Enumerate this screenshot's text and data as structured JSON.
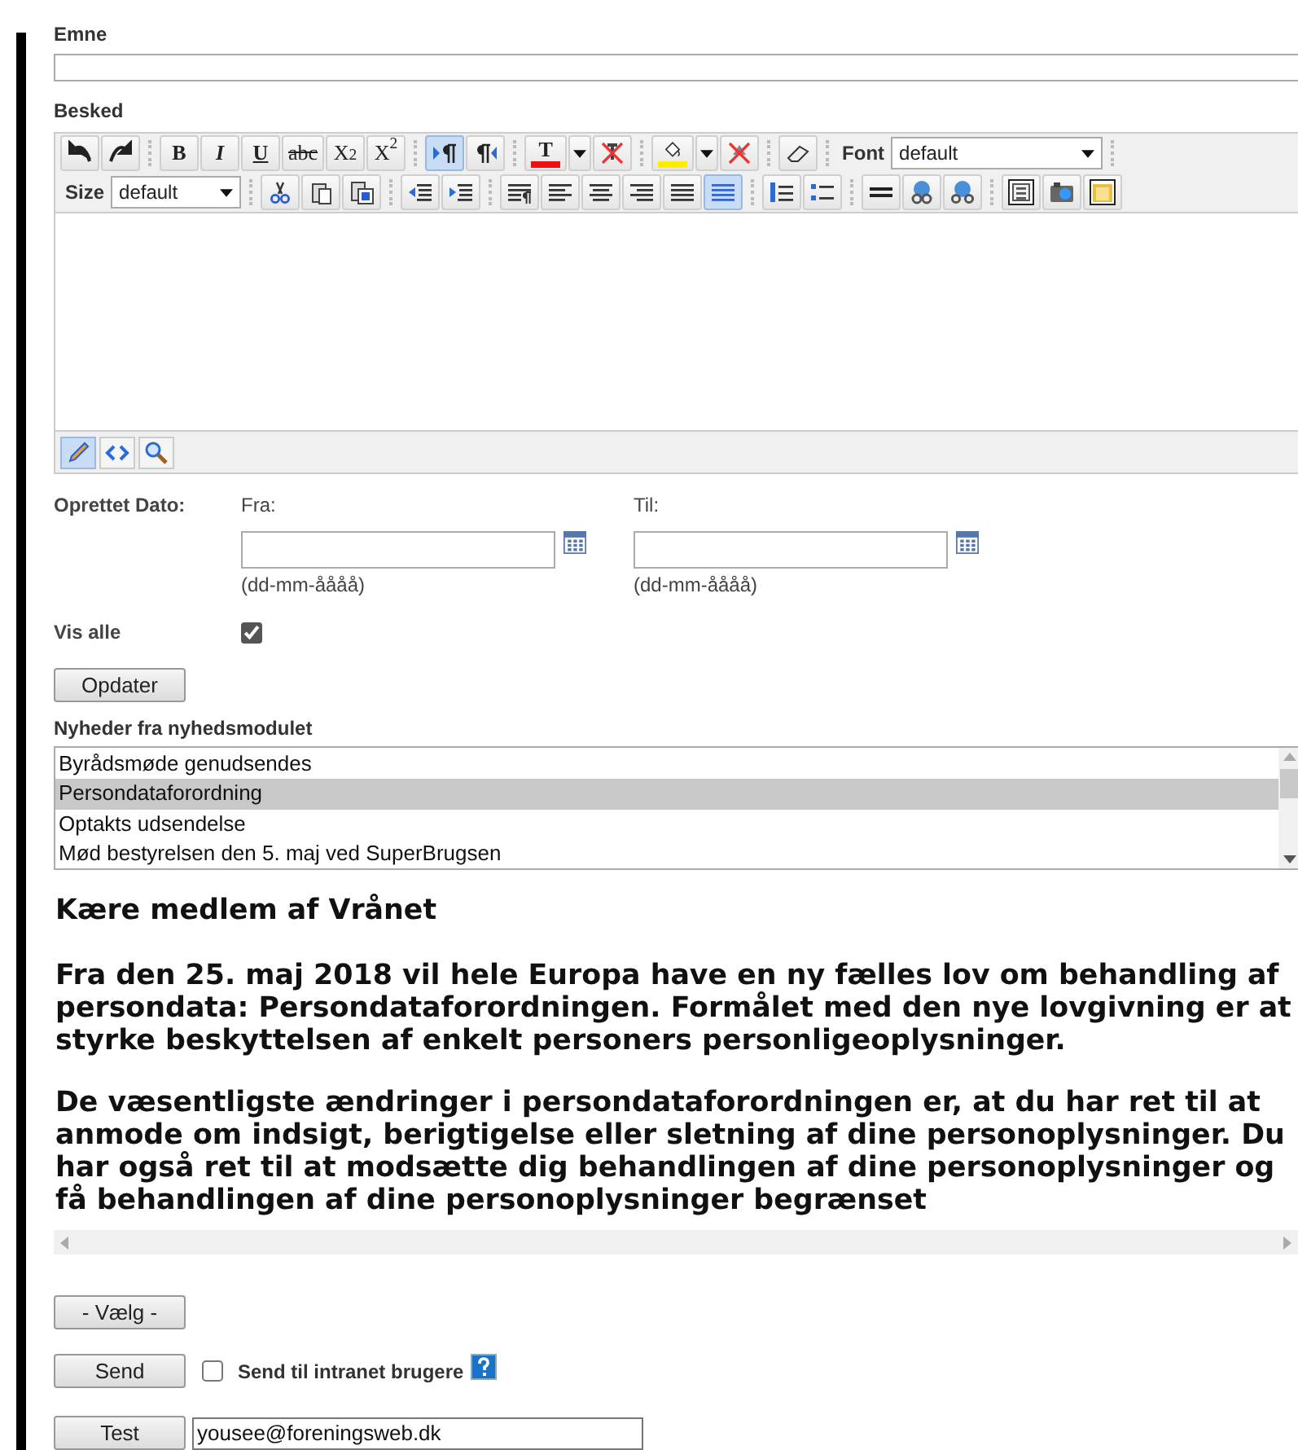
{
  "subject": {
    "label": "Emne"
  },
  "message": {
    "label": "Besked",
    "toolbar_rows": [
      [
        {
          "kind": "icon",
          "selected": false
        },
        {
          "kind": "icon",
          "selected": false
        },
        {
          "kind": "sep"
        },
        {
          "kind": "text",
          "label": "B",
          "selected": false
        },
        {
          "kind": "text",
          "label": "I",
          "selected": false
        },
        {
          "kind": "text",
          "label": "U",
          "selected": false
        },
        {
          "kind": "text",
          "label": "abc",
          "selected": false
        },
        {
          "kind": "text",
          "label": "X$_{2}$",
          "selected": false
        },
        {
          "kind": "text",
          "label": "X$^{2}$",
          "selected": false
        },
        {
          "kind": "sep"
        },
        {
          "kind": "icon",
          "selected": true
        },
        {
          "kind": "icon",
          "selected": false
        },
        {
          "kind": "sep"
        },
        {
          "kind": "color",
          "label": "T",
          "color": "#ee1111"
        },
        {
          "kind": "caret"
        },
        {
          "kind": "icon",
          "selected": false
        },
        {
          "kind": "sep"
        },
        {
          "kind": "color",
          "color": "#ffee00"
        },
        {
          "kind": "caret"
        },
        {
          "kind": "icon",
          "selected": false
        },
        {
          "kind": "sep"
        },
        {
          "kind": "icon",
          "selected": false
        },
        {
          "kind": "sep"
        },
        {
          "kind": "select",
          "label": "Font",
          "value": "default"
        },
        {
          "kind": "sep"
        }
      ],
      [
        {
          "kind": "select",
          "label": "Size",
          "value": "default"
        },
        {
          "kind": "sep"
        },
        {
          "kind": "icon",
          "selected": false
        },
        {
          "kind": "icon",
          "selected": false
        },
        {
          "kind": "icon",
          "selected": false
        },
        {
          "kind": "sep"
        },
        {
          "kind": "icon",
          "selected": false
        },
        {
          "kind": "icon",
          "selected": false
        },
        {
          "kind": "sep"
        },
        {
          "kind": "icon",
          "selected": false
        },
        {
          "kind": "icon",
          "selected": false
        },
        {
          "kind": "icon",
          "selected": false
        },
        {
          "kind": "icon",
          "selected": false
        },
        {
          "kind": "icon",
          "selected": false
        },
        {
          "kind": "icon",
          "selected": true
        },
        {
          "kind": "sep"
        },
        {
          "kind": "icon",
          "selected": false
        },
        {
          "kind": "icon",
          "selected": false
        },
        {
          "kind": "sep"
        },
        {
          "kind": "icon",
          "selected": false
        },
        {
          "kind": "icon",
          "selected": false
        },
        {
          "kind": "icon",
          "selected": false
        },
        {
          "kind": "sep"
        },
        {
          "kind": "icon",
          "selected": false
        },
        {
          "kind": "icon",
          "selected": false
        },
        {
          "kind": "icon",
          "selected": false
        }
      ]
    ],
    "modes": [
      {
        "selected": true
      },
      {
        "selected": false
      },
      {
        "selected": false
      }
    ]
  },
  "created_date": {
    "label": "Oprettet Dato:",
    "from": {
      "label": "Fra:",
      "hint": "(dd-mm-åååå)"
    },
    "to": {
      "label": "Til:",
      "hint": "(dd-mm-åååå)"
    }
  },
  "show_all": {
    "label": "Vis alle",
    "checked": true
  },
  "update_button": "Opdater",
  "news": {
    "label": "Nyheder fra nyhedsmodulet",
    "items": [
      {
        "title": "Byrådsmøde genudsendes",
        "selected": false
      },
      {
        "title": "Persondataforordning",
        "selected": true
      },
      {
        "title": "Optakts udsendelse",
        "selected": false
      },
      {
        "title": "Mød bestyrelsen den 5. maj ved SuperBrugsen",
        "selected": false
      }
    ]
  },
  "preview": {
    "heading": "Kære medlem af Vrånet",
    "paragraphs": [
      "Fra den 25. maj 2018 vil hele Europa have en ny fælles lov om behandling af persondata: Persondataforordningen. Formålet med den nye lovgivning er at styrke beskyttelsen af enkelt personers personligeoplysninger.",
      "De væsentligste ændringer i persondataforordningen er, at du har ret til at anmode om indsigt, berigtigelse eller sletning af dine personoplysninger. Du har også ret til at modsætte dig behandlingen af dine personoplysninger og få behandlingen af dine personoplysninger begrænset"
    ]
  },
  "choose_button": "- Vælg -",
  "send": {
    "button": "Send",
    "intranet": {
      "label": "Send til intranet brugere",
      "checked": false
    }
  },
  "test": {
    "button": "Test",
    "email": "yousee@foreningsweb.dk"
  }
}
